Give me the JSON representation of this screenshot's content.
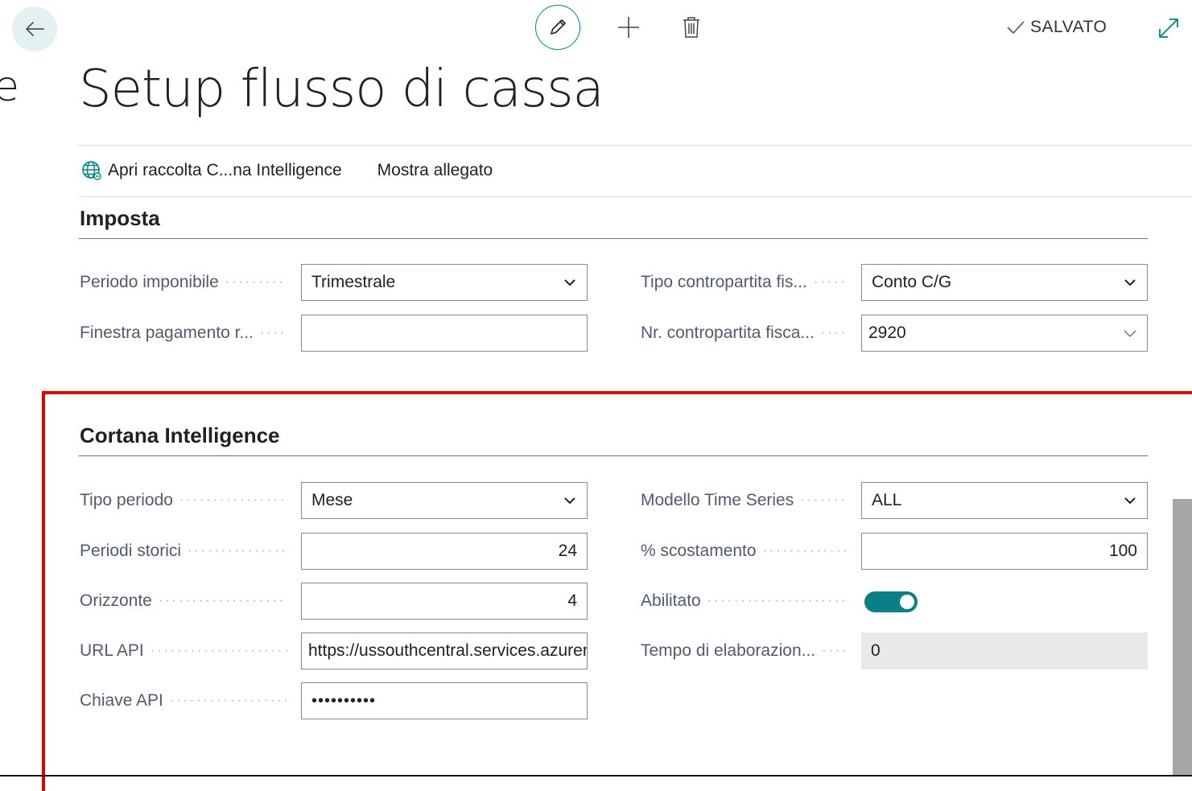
{
  "header": {
    "saved_label": "SALVATO",
    "left_edge_text": "e"
  },
  "page": {
    "title": "Setup flusso di cassa"
  },
  "actions": [
    {
      "label": "Apri raccolta C...na Intelligence",
      "icon": "globe-icon"
    },
    {
      "label": "Mostra allegato"
    }
  ],
  "sections": {
    "imposta": {
      "title": "Imposta",
      "fields": {
        "periodo_imponibile": {
          "label": "Periodo imponibile",
          "value": "Trimestrale"
        },
        "finestra_pagamento": {
          "label": "Finestra pagamento r...",
          "value": ""
        },
        "tipo_contropartita": {
          "label": "Tipo contropartita fis...",
          "value": "Conto C/G"
        },
        "nr_contropartita": {
          "label": "Nr. contropartita fisca...",
          "value": "2920"
        }
      }
    },
    "cortana": {
      "title": "Cortana Intelligence",
      "fields": {
        "tipo_periodo": {
          "label": "Tipo periodo",
          "value": "Mese"
        },
        "periodi_storici": {
          "label": "Periodi storici",
          "value": "24"
        },
        "orizzonte": {
          "label": "Orizzonte",
          "value": "4"
        },
        "url_api": {
          "label": "URL API",
          "value": "https://ussouthcentral.services.azureml.net"
        },
        "chiave_api": {
          "label": "Chiave API",
          "value": "••••••••••"
        },
        "modello_time_series": {
          "label": "Modello Time Series",
          "value": "ALL"
        },
        "scostamento": {
          "label": "% scostamento",
          "value": "100"
        },
        "abilitato": {
          "label": "Abilitato",
          "value": true
        },
        "tempo_elaborazione": {
          "label": "Tempo di elaborazion...",
          "value": "0"
        }
      }
    }
  },
  "colors": {
    "accent": "#008489",
    "toggle_on": "#0a7f86",
    "highlight": "#e00000"
  }
}
